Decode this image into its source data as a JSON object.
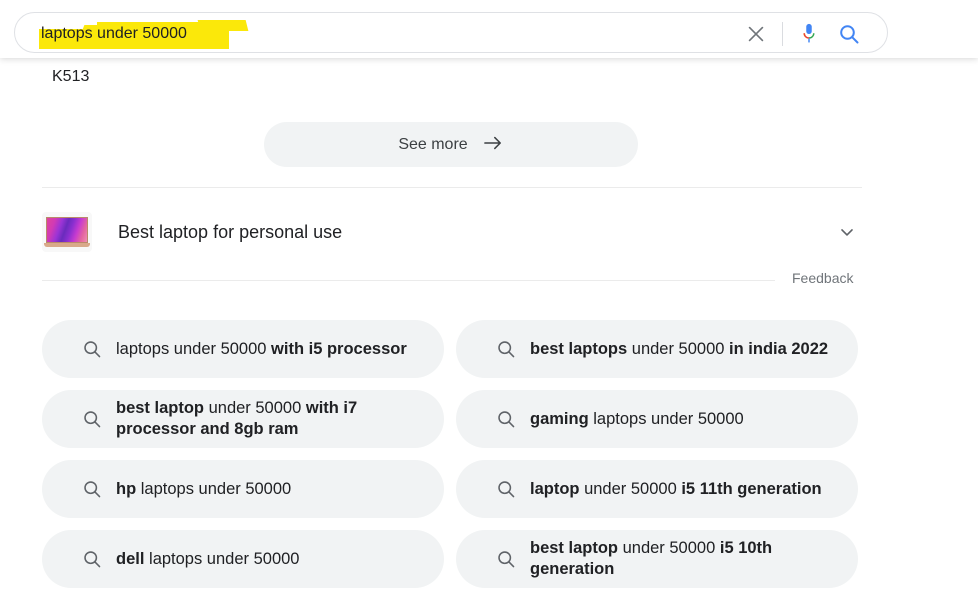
{
  "search": {
    "query": "laptops under 50000",
    "highlight_color": "#fbe80a",
    "clear_icon": "close-icon",
    "voice_icon": "microphone-icon",
    "search_icon": "search-icon"
  },
  "content": {
    "truncated_result": "K513",
    "see_more_label": "See more",
    "see_more_icon": "arrow-right-icon",
    "related_search": {
      "title": "Best laptop for personal use",
      "thumbnail": "laptop-thumbnail",
      "expand_icon": "chevron-down-icon"
    },
    "feedback_label": "Feedback"
  },
  "suggestions": [
    {
      "icon": "search-icon",
      "parts": [
        {
          "text": "laptops under 50000 ",
          "bold": false
        },
        {
          "text": "with i5 processor",
          "bold": true
        }
      ],
      "plain": "laptops under 50000 with i5 processor"
    },
    {
      "icon": "search-icon",
      "parts": [
        {
          "text": "best laptops",
          "bold": true
        },
        {
          "text": " under 50000 ",
          "bold": false
        },
        {
          "text": "in india 2022",
          "bold": true
        }
      ],
      "plain": "best laptops under 50000 in india 2022"
    },
    {
      "icon": "search-icon",
      "parts": [
        {
          "text": "best laptop",
          "bold": true
        },
        {
          "text": " under 50000 ",
          "bold": false
        },
        {
          "text": "with i7 processor and 8gb ram",
          "bold": true
        }
      ],
      "plain": "best laptop under 50000 with i7 processor and 8gb ram"
    },
    {
      "icon": "search-icon",
      "parts": [
        {
          "text": "gaming",
          "bold": true
        },
        {
          "text": " laptops under 50000",
          "bold": false
        }
      ],
      "plain": "gaming laptops under 50000"
    },
    {
      "icon": "search-icon",
      "parts": [
        {
          "text": "hp",
          "bold": true
        },
        {
          "text": " laptops under 50000",
          "bold": false
        }
      ],
      "plain": "hp laptops under 50000"
    },
    {
      "icon": "search-icon",
      "parts": [
        {
          "text": "laptop",
          "bold": true
        },
        {
          "text": " under 50000 ",
          "bold": false
        },
        {
          "text": "i5 11th generation",
          "bold": true
        }
      ],
      "plain": "laptop under 50000 i5 11th generation"
    },
    {
      "icon": "search-icon",
      "parts": [
        {
          "text": "dell",
          "bold": true
        },
        {
          "text": " laptops under 50000",
          "bold": false
        }
      ],
      "plain": "dell laptops under 50000"
    },
    {
      "icon": "search-icon",
      "parts": [
        {
          "text": "best laptop",
          "bold": true
        },
        {
          "text": " under 50000 ",
          "bold": false
        },
        {
          "text": "i5 10th generation",
          "bold": true
        }
      ],
      "plain": "best laptop under 50000 i5 10th generation"
    }
  ]
}
